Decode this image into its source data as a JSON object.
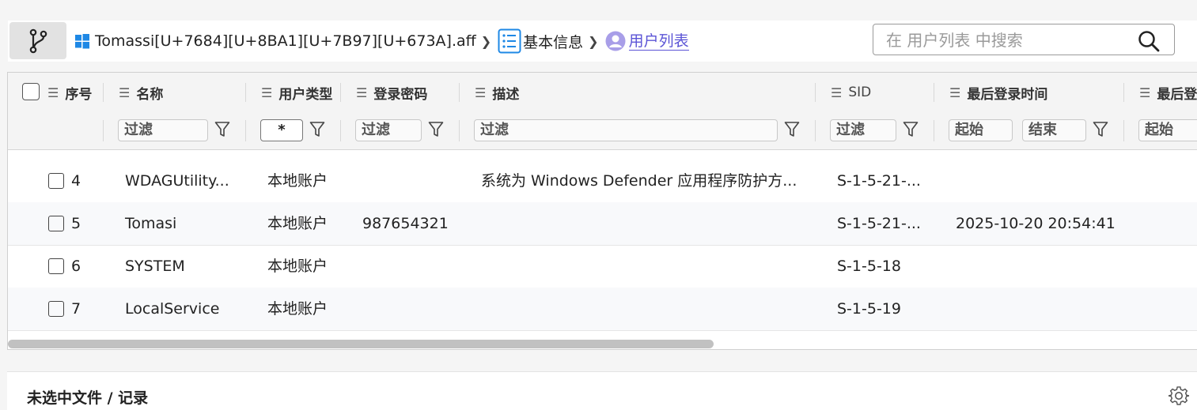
{
  "breadcrumb": {
    "file": "Tomassi[U+7684][U+8BA1][U+7B97][U+673A].aff",
    "section": "基本信息",
    "current": "用户列表"
  },
  "search": {
    "placeholder": "在 用户列表 中搜索"
  },
  "columns": [
    "序号",
    "名称",
    "用户类型",
    "登录密码",
    "描述",
    "SID",
    "最后登录时间",
    "最后登"
  ],
  "filters": {
    "name": "过滤",
    "type": "*",
    "password": "过滤",
    "description": "过滤",
    "sid": "过滤",
    "last_login_start": "起始",
    "last_login_end": "结束",
    "next_start": "起始"
  },
  "rows": [
    {
      "index": "4",
      "name": "WDAGUtility...",
      "type": "本地账户",
      "password": "",
      "description": "系统为 Windows Defender 应用程序防护方...",
      "sid": "S-1-5-21-...",
      "last_login": ""
    },
    {
      "index": "5",
      "name": "Tomasi",
      "type": "本地账户",
      "password": "987654321",
      "description": "",
      "sid": "S-1-5-21-...",
      "last_login": "2025-10-20 20:54:41"
    },
    {
      "index": "6",
      "name": "SYSTEM",
      "type": "本地账户",
      "password": "",
      "description": "",
      "sid": "S-1-5-18",
      "last_login": ""
    },
    {
      "index": "7",
      "name": "LocalService",
      "type": "本地账户",
      "password": "",
      "description": "",
      "sid": "S-1-5-19",
      "last_login": ""
    }
  ],
  "detail_panel": {
    "title": "未选中文件 / 记录"
  },
  "icons": {
    "branch": "git-branch-icon",
    "windows": "windows-logo-icon",
    "list": "list-icon",
    "user": "user-avatar-icon",
    "search": "search-icon",
    "filter": "funnel-icon",
    "settings": "gear-icon"
  },
  "colors": {
    "accent": "#5b54d6",
    "icon_blue": "#1e88e5",
    "user_icon": "#a89ee8"
  }
}
